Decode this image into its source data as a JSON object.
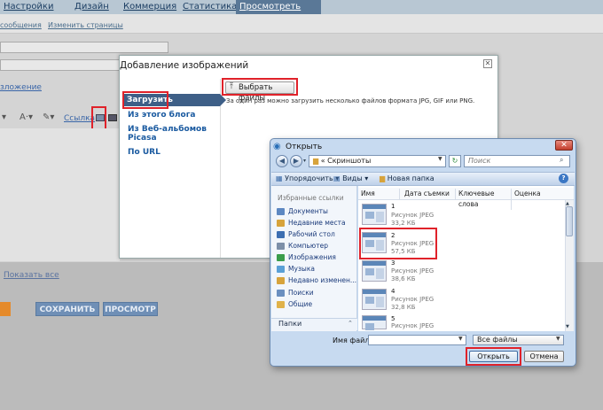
{
  "colors": {
    "accent": "#3e5f87",
    "highlight": "#e0222a",
    "link": "#1a5aa0"
  },
  "blogger": {
    "nav_tabs": [
      "Настройки",
      "Дизайн",
      "Коммерция",
      "Статистика"
    ],
    "nav_active": "Просмотреть блог",
    "sub_links": [
      "сообщения",
      "Изменить страницы"
    ],
    "edit_link_fragment": "зложение",
    "toolbar_link": "Ссылка",
    "show_all": "Показать все",
    "buttons": {
      "save": "СОХРАНИТЬ",
      "preview": "ПРОСМОТР"
    }
  },
  "add_images_dialog": {
    "title": "Добавление изображений",
    "close": "✕",
    "sidebar": [
      "Загрузить",
      "Из этого блога",
      "Из Веб-альбомов Picasa",
      "По URL"
    ],
    "choose_button": "Выбрать файлы",
    "choose_icon": "upload-icon",
    "hint": "За один раз можно загрузить несколько файлов формата JPG, GIF или PNG."
  },
  "open_dialog": {
    "title": "Открыть",
    "close": "✕",
    "address": "« Скриншоты",
    "search_placeholder": "Поиск",
    "commands": {
      "organize": "Упорядочить",
      "views": "Виды",
      "new_folder": "Новая папка"
    },
    "favorites_header": "Избранные ссылки",
    "favorites": [
      {
        "label": "Документы",
        "color": "#5d88c2"
      },
      {
        "label": "Недавние места",
        "color": "#d7a33b"
      },
      {
        "label": "Рабочий стол",
        "color": "#3d6fb2"
      },
      {
        "label": "Компьютер",
        "color": "#7c8fa8"
      },
      {
        "label": "Изображения",
        "color": "#3a9d4b"
      },
      {
        "label": "Музыка",
        "color": "#5aa0d6"
      },
      {
        "label": "Недавно изменен...",
        "color": "#d7a33b"
      },
      {
        "label": "Поиски",
        "color": "#6a8fc0"
      },
      {
        "label": "Общие",
        "color": "#e0b24a"
      }
    ],
    "folders_label": "Папки",
    "columns": [
      "Имя",
      "Дата съемки",
      "Ключевые слова",
      "Оценка"
    ],
    "files": [
      {
        "num": "1",
        "type": "Рисунок JPEG",
        "size": "33,2 КБ"
      },
      {
        "num": "2",
        "type": "Рисунок JPEG",
        "size": "57,5 КБ"
      },
      {
        "num": "3",
        "type": "Рисунок JPEG",
        "size": "38,6 КБ"
      },
      {
        "num": "4",
        "type": "Рисунок JPEG",
        "size": "32,8 КБ"
      },
      {
        "num": "5",
        "type": "Рисунок JPEG",
        "size": ""
      }
    ],
    "filename_label": "Имя файла:",
    "filename_value": "",
    "filetype": "Все файлы",
    "open_button": "Открыть",
    "cancel_button": "Отмена"
  }
}
